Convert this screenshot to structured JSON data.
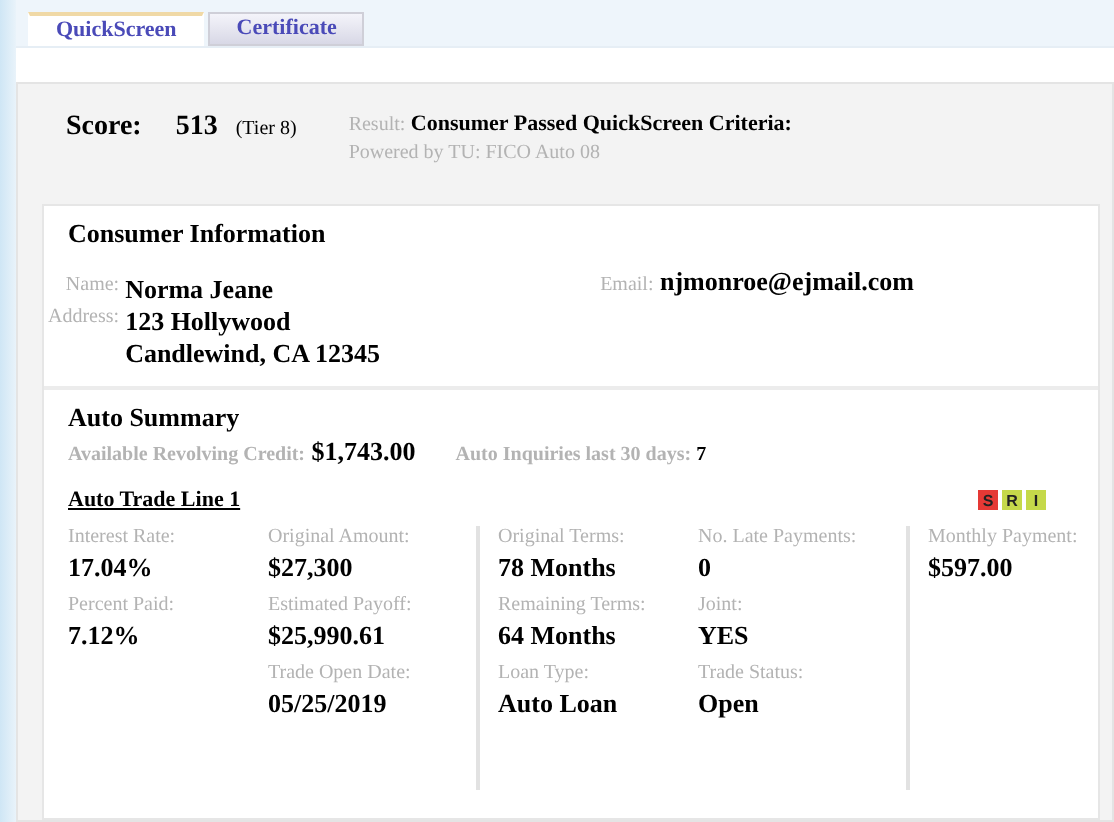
{
  "tabs": [
    {
      "label": "QuickScreen",
      "selected": true
    },
    {
      "label": "Certificate",
      "selected": false
    }
  ],
  "score": {
    "label": "Score:",
    "value": "513",
    "tier": "(Tier 8)",
    "result_label": "Result:",
    "result": "Consumer Passed QuickScreen Criteria:",
    "powered_by": "Powered by TU: FICO Auto 08"
  },
  "consumer": {
    "title": "Consumer Information",
    "name_label": "Name:",
    "name": "Norma Jeane",
    "email_label": "Email:",
    "email": "njmonroe@ejmail.com",
    "address_label": "Address:",
    "address_lines": [
      "123 Hollywood",
      "Candlewind, CA 12345"
    ]
  },
  "auto_summary": {
    "title": "Auto Summary",
    "credit_label": "Available Revolving Credit:",
    "credit": "$1,743.00",
    "inquiries_label": "Auto Inquiries last 30 days:",
    "inquiries": "7",
    "trade_line": {
      "title": "Auto Trade Line 1",
      "badges": [
        {
          "label": "S",
          "color": "#e53935"
        },
        {
          "label": "R",
          "color": "#c5d94a"
        },
        {
          "label": "I",
          "color": "#c5d94a"
        }
      ],
      "groups": [
        [
          [
            {
              "label": "Interest Rate:",
              "value": "17.04%"
            },
            {
              "label": "Percent Paid:",
              "value": "7.12%"
            }
          ],
          [
            {
              "label": "Original Amount:",
              "value": "$27,300"
            },
            {
              "label": "Estimated Payoff:",
              "value": "$25,990.61"
            },
            {
              "label": "Trade Open Date:",
              "value": "05/25/2019"
            }
          ]
        ],
        [
          [
            {
              "label": "Original Terms:",
              "value": "78 Months"
            },
            {
              "label": "Remaining Terms:",
              "value": "64 Months"
            },
            {
              "label": "Loan Type:",
              "value": "Auto Loan"
            }
          ],
          [
            {
              "label": "No. Late Payments:",
              "value": "0"
            },
            {
              "label": "Joint:",
              "value": "YES"
            },
            {
              "label": "Trade Status:",
              "value": "Open"
            }
          ]
        ],
        [
          [
            {
              "label": "Monthly Payment:",
              "value": "$597.00"
            }
          ]
        ]
      ]
    }
  }
}
